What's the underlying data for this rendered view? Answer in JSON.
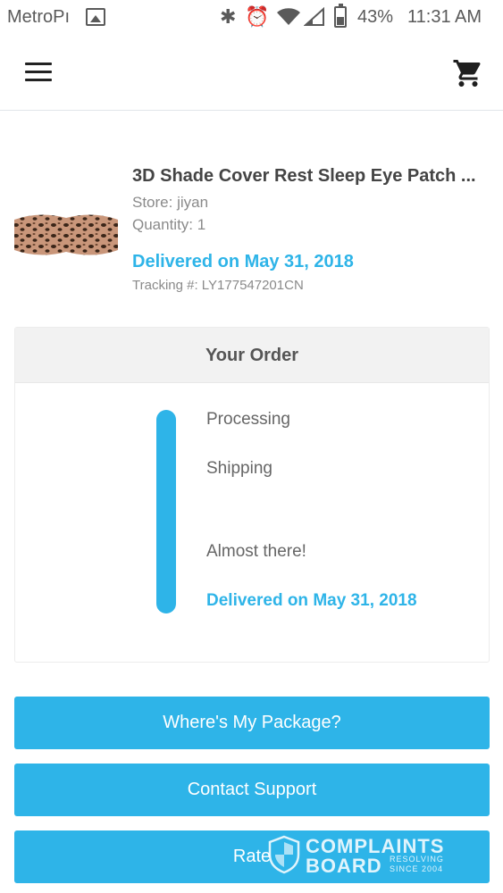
{
  "status_bar": {
    "carrier": "MetroPı",
    "battery_pct": "43%",
    "battery_level": 0.43,
    "time": "11:31 AM"
  },
  "header": {
    "menu_icon": "hamburger-menu-icon",
    "cart_icon": "shopping-cart-icon"
  },
  "product": {
    "title": "3D Shade Cover Rest Sleep Eye Patch ...",
    "store": "Store: jiyan",
    "quantity": "Quantity: 1",
    "delivered": "Delivered on May 31, 2018",
    "tracking": "Tracking #: LY177547201CN",
    "image": "leopard-eye-mask"
  },
  "order": {
    "title": "Your Order",
    "steps": [
      "Processing",
      "Shipping",
      "Almost there!",
      "Delivered on May 31, 2018"
    ],
    "accent_color": "#2eb4e8"
  },
  "buttons": {
    "package": "Where's My Package?",
    "support": "Contact Support",
    "rate": "Rate"
  },
  "watermark": {
    "line1": "COMPLAINTS",
    "line2": "BOARD",
    "line3": "RESOLVING SINCE 2004"
  }
}
